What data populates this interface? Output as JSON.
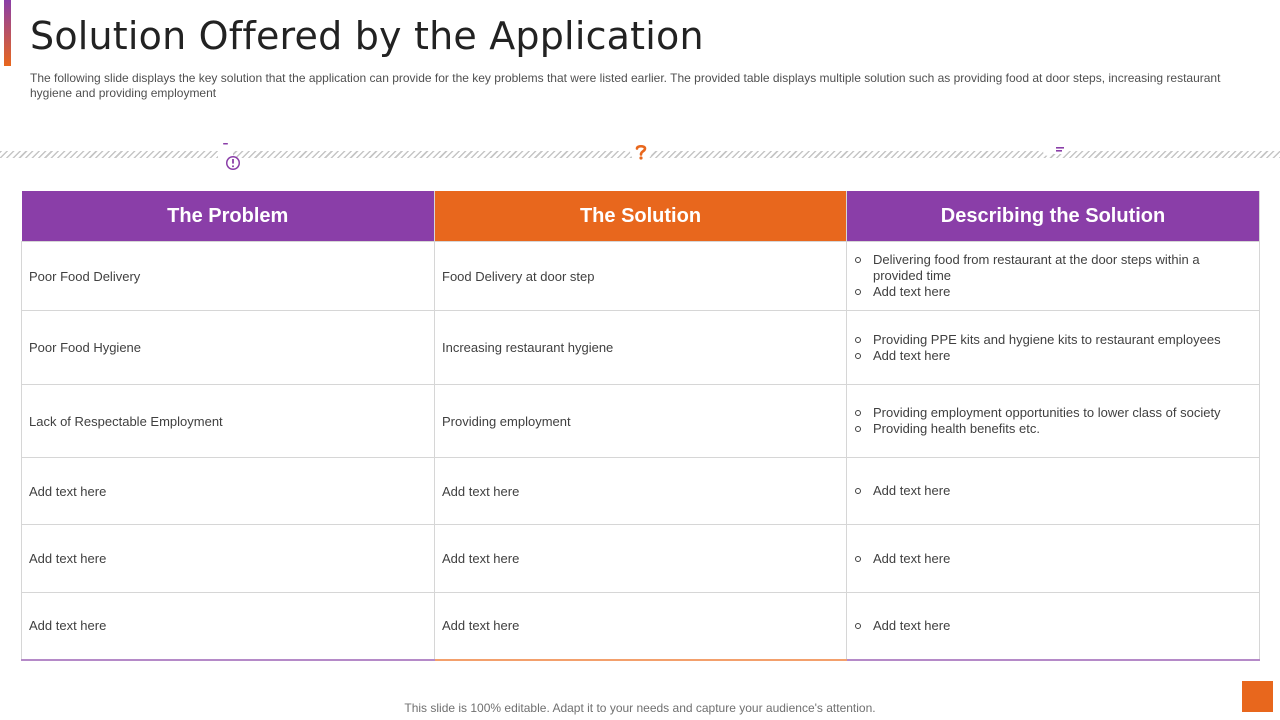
{
  "header": {
    "title": "Solution Offered by the Application",
    "subtitle": "The following slide displays the key solution that the application can provide for the key problems that were listed earlier. The provided table displays multiple solution such as providing food at door steps, increasing restaurant hygiene and providing employment"
  },
  "icons": [
    {
      "name": "mobile-alert-icon",
      "color": "#8a3ea8"
    },
    {
      "name": "lightbulb-question-icon",
      "color": "#e8671d"
    },
    {
      "name": "user-card-icon",
      "color": "#8a3ea8"
    }
  ],
  "table": {
    "headers": [
      "The Problem",
      "The Solution",
      "Describing the Solution"
    ],
    "header_colors": [
      "#8a3ea8",
      "#e8671d",
      "#8a3ea8"
    ],
    "rows": [
      {
        "problem": "Poor Food Delivery",
        "solution": "Food Delivery  at door step",
        "description": [
          "Delivering  food  from  restaurant  at the door  steps within  a  provided  time",
          "Add text here"
        ]
      },
      {
        "problem": "Poor Food Hygiene",
        "solution": "Increasing  restaurant  hygiene",
        "description": [
          "Providing  PPE kits and hygiene  kits to restaurant  employees",
          "Add text here"
        ]
      },
      {
        "problem": "Lack of Respectable  Employment",
        "solution": "Providing  employment",
        "description": [
          "Providing  employment  opportunities to lower  class of society",
          "Providing  health  benefits  etc."
        ]
      },
      {
        "problem": "Add text here",
        "solution": "Add text here",
        "description": [
          "Add text here"
        ]
      },
      {
        "problem": "Add text here",
        "solution": "Add text here",
        "description": [
          "Add text here"
        ]
      },
      {
        "problem": "Add text here",
        "solution": "Add text here",
        "description": [
          "Add text here"
        ]
      }
    ]
  },
  "footer": {
    "note": "This slide is 100% editable. Adapt it to your needs and capture your audience's attention."
  }
}
